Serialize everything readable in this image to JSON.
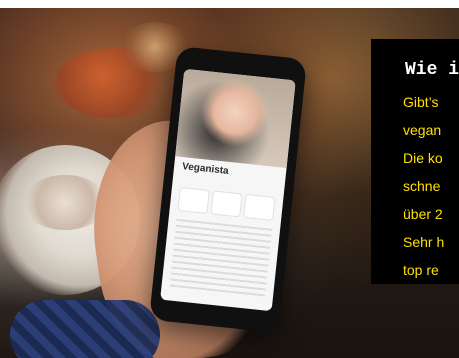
{
  "phone": {
    "app_title": "Veganista"
  },
  "quote": {
    "title": "Wie i",
    "lines": [
      "Gibt’s",
      "vegan",
      "Die ko",
      "schne",
      "über 2",
      "Sehr h",
      "top re"
    ]
  }
}
